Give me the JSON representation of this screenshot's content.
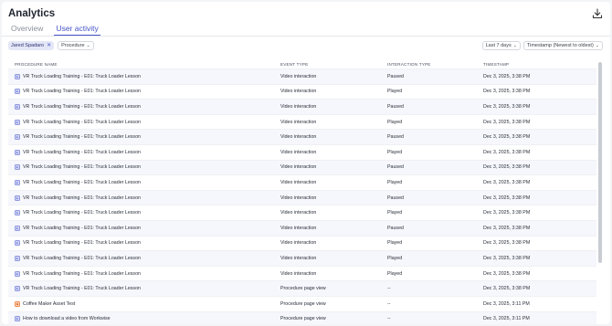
{
  "header": {
    "title": "Analytics",
    "download_icon": "download-icon"
  },
  "tabs": [
    {
      "label": "Overview",
      "active": false
    },
    {
      "label": "User activity",
      "active": true
    }
  ],
  "filters": {
    "user_chip": "Jared Spadaro",
    "procedure_dropdown": "Procedure",
    "date_range": "Last 7 days",
    "sort": "Timestamp (Newest to oldest)"
  },
  "columns": [
    "PROCEDURE NAME",
    "EVENT TYPE",
    "INTERACTION TYPE",
    "TIMESTAMP"
  ],
  "rows": [
    {
      "name": "VR Truck Loading Training - E01: Truck Loader Lesson",
      "event": "Video interaction",
      "interaction": "Paused",
      "time": "Dec 3, 2025, 3:38 PM",
      "icon": "procedure-icon"
    },
    {
      "name": "VR Truck Loading Training - E01: Truck Loader Lesson",
      "event": "Video interaction",
      "interaction": "Played",
      "time": "Dec 3, 2025, 3:38 PM",
      "icon": "procedure-icon"
    },
    {
      "name": "VR Truck Loading Training - E01: Truck Loader Lesson",
      "event": "Video interaction",
      "interaction": "Paused",
      "time": "Dec 3, 2025, 3:38 PM",
      "icon": "procedure-icon"
    },
    {
      "name": "VR Truck Loading Training - E01: Truck Loader Lesson",
      "event": "Video interaction",
      "interaction": "Played",
      "time": "Dec 3, 2025, 3:38 PM",
      "icon": "procedure-icon"
    },
    {
      "name": "VR Truck Loading Training - E01: Truck Loader Lesson",
      "event": "Video interaction",
      "interaction": "Paused",
      "time": "Dec 3, 2025, 3:38 PM",
      "icon": "procedure-icon"
    },
    {
      "name": "VR Truck Loading Training - E01: Truck Loader Lesson",
      "event": "Video interaction",
      "interaction": "Played",
      "time": "Dec 3, 2025, 3:38 PM",
      "icon": "procedure-icon"
    },
    {
      "name": "VR Truck Loading Training - E01: Truck Loader Lesson",
      "event": "Video interaction",
      "interaction": "Paused",
      "time": "Dec 3, 2025, 3:38 PM",
      "icon": "procedure-icon"
    },
    {
      "name": "VR Truck Loading Training - E01: Truck Loader Lesson",
      "event": "Video interaction",
      "interaction": "Played",
      "time": "Dec 3, 2025, 3:38 PM",
      "icon": "procedure-icon"
    },
    {
      "name": "VR Truck Loading Training - E01: Truck Loader Lesson",
      "event": "Video interaction",
      "interaction": "Paused",
      "time": "Dec 3, 2025, 3:38 PM",
      "icon": "procedure-icon"
    },
    {
      "name": "VR Truck Loading Training - E01: Truck Loader Lesson",
      "event": "Video interaction",
      "interaction": "Played",
      "time": "Dec 3, 2025, 3:38 PM",
      "icon": "procedure-icon"
    },
    {
      "name": "VR Truck Loading Training - E01: Truck Loader Lesson",
      "event": "Video interaction",
      "interaction": "Paused",
      "time": "Dec 3, 2025, 3:38 PM",
      "icon": "procedure-icon"
    },
    {
      "name": "VR Truck Loading Training - E01: Truck Loader Lesson",
      "event": "Video interaction",
      "interaction": "Played",
      "time": "Dec 3, 2025, 3:38 PM",
      "icon": "procedure-icon"
    },
    {
      "name": "VR Truck Loading Training - E01: Truck Loader Lesson",
      "event": "Video interaction",
      "interaction": "Played",
      "time": "Dec 3, 2025, 3:38 PM",
      "icon": "procedure-icon"
    },
    {
      "name": "VR Truck Loading Training - E01: Truck Loader Lesson",
      "event": "Video interaction",
      "interaction": "Played",
      "time": "Dec 3, 2025, 3:38 PM",
      "icon": "procedure-icon"
    },
    {
      "name": "VR Truck Loading Training - E01: Truck Loader Lesson",
      "event": "Procedure page view",
      "interaction": "--",
      "time": "Dec 3, 2025, 3:38 PM",
      "icon": "procedure-icon"
    },
    {
      "name": "Coffee Maker Asset Test",
      "event": "Procedure page view",
      "interaction": "--",
      "time": "Dec 3, 2025, 3:11 PM",
      "icon": "asset-icon"
    },
    {
      "name": "How to download a video from Workwise",
      "event": "Procedure page view",
      "interaction": "--",
      "time": "Dec 3, 2025, 3:11 PM",
      "icon": "procedure-icon"
    }
  ],
  "colors": {
    "accent": "#4654c9",
    "chip_bg": "#e4e7f7",
    "stripe": "#f6f7fc",
    "asset_icon": "#f08b4e"
  }
}
